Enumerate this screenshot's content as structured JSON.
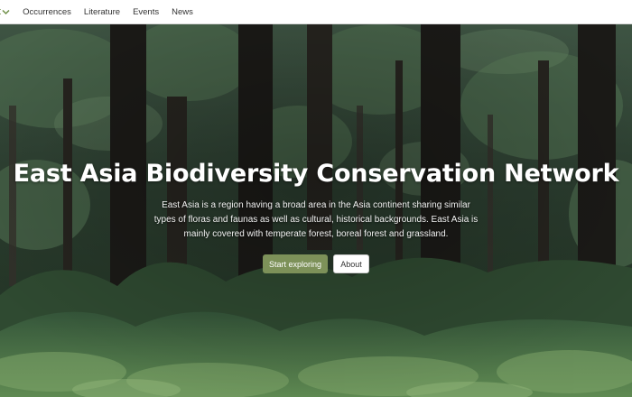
{
  "nav": {
    "items": [
      {
        "label": "Occurrences"
      },
      {
        "label": "Literature"
      },
      {
        "label": "Events"
      },
      {
        "label": "News"
      }
    ],
    "accent_color": "#6f8f47",
    "partial_icon": "chevron-down-icon"
  },
  "hero": {
    "title": "East Asia Biodiversity Conservation Network",
    "description": "East Asia is a region having a broad area in the Asia continent sharing similar types of floras and faunas as well as cultural, historical backgrounds. East Asia is mainly covered with temperate forest, boreal forest and grassland.",
    "primary_button": "Start exploring",
    "secondary_button": "About",
    "primary_color": "#7d9159"
  }
}
